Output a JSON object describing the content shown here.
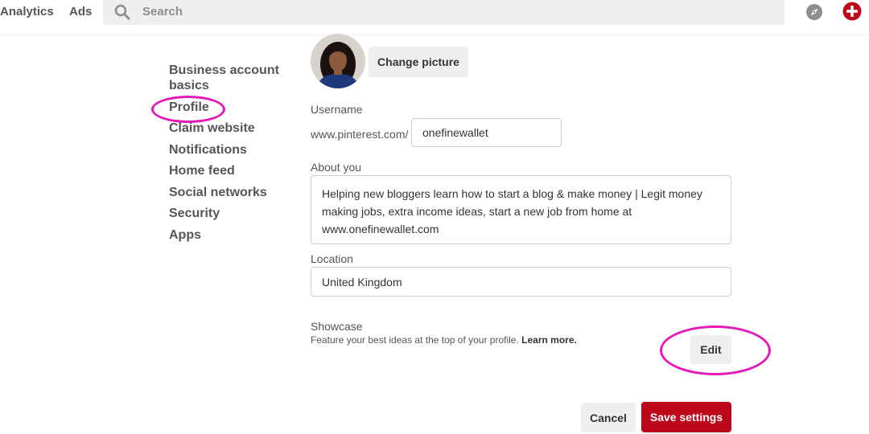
{
  "topbar": {
    "nav": [
      "Analytics",
      "Ads"
    ],
    "search_placeholder": "Search",
    "search_icon": "search-icon",
    "explore_icon": "compass-icon",
    "create_icon": "plus-icon",
    "brand_color": "#bd081c"
  },
  "sidebar": {
    "items": [
      {
        "label": "Business account basics"
      },
      {
        "label": "Profile",
        "highlighted": true
      },
      {
        "label": "Claim website"
      },
      {
        "label": "Notifications"
      },
      {
        "label": "Home feed"
      },
      {
        "label": "Social networks"
      },
      {
        "label": "Security"
      },
      {
        "label": "Apps"
      }
    ],
    "highlight_color": "#e619b8"
  },
  "profile": {
    "change_picture_label": "Change picture",
    "username_label": "Username",
    "url_prefix": "www.pinterest.com/",
    "username_value": "onefinewallet",
    "about_label": "About you",
    "about_value": "Helping new bloggers learn how to start a blog & make money | Legit money making jobs, extra income ideas, start a new job from home at www.onefinewallet.com",
    "location_label": "Location",
    "location_value": "United Kingdom",
    "showcase_label": "Showcase",
    "showcase_desc": "Feature your best ideas at the top of your profile.",
    "learn_more": "Learn more.",
    "edit_label": "Edit"
  },
  "actions": {
    "cancel_label": "Cancel",
    "save_label": "Save settings"
  }
}
